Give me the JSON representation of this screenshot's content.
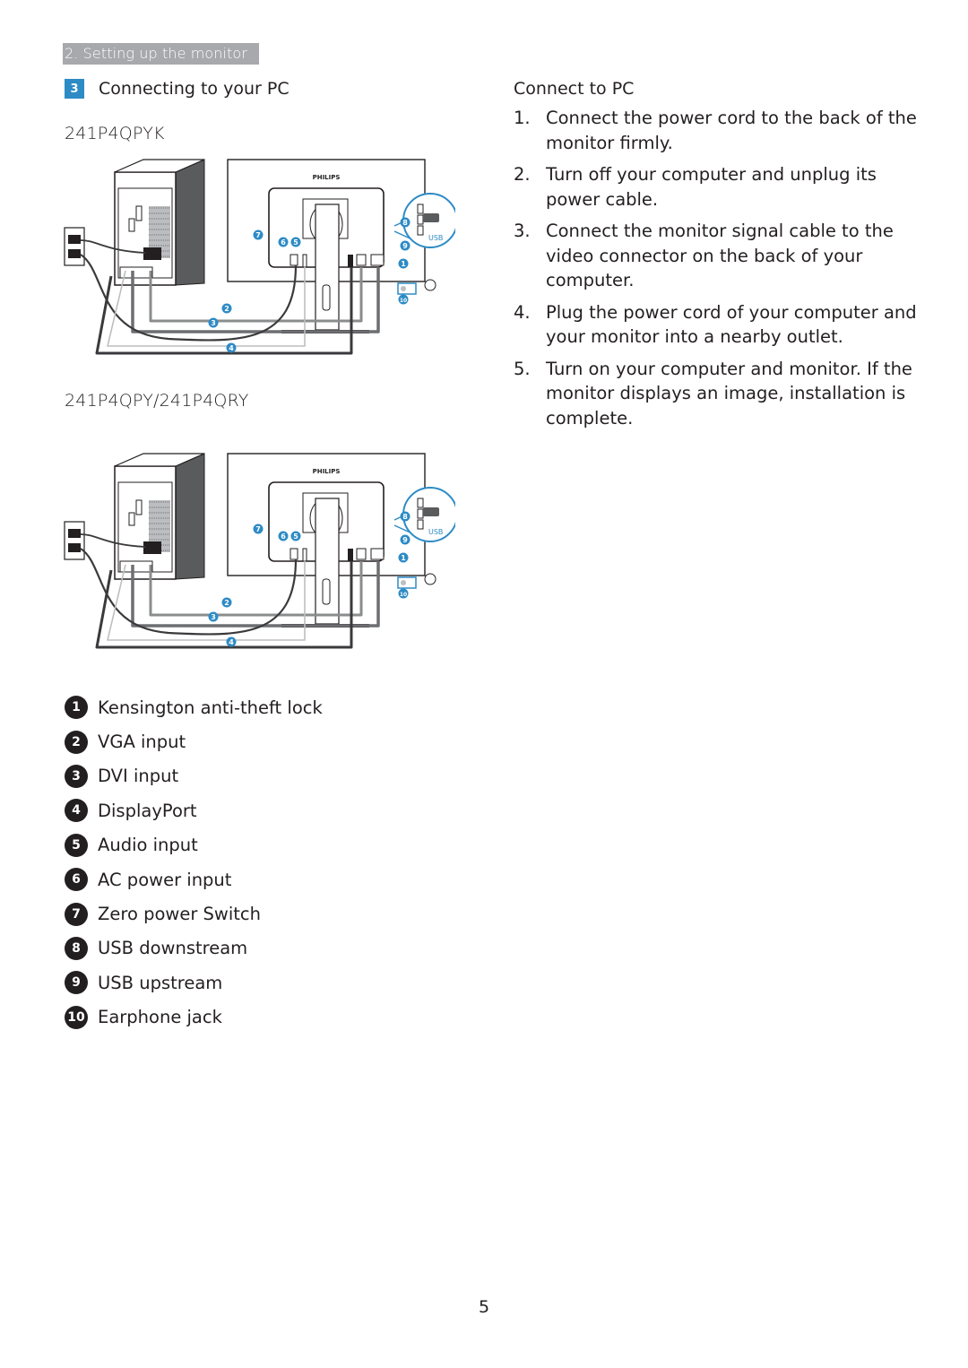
{
  "section_tab": "2. Setting up the monitor",
  "heading": {
    "number": "3",
    "title": "Connecting to your PC"
  },
  "diagrams": [
    {
      "model": "241P4QPYK",
      "brand": "PHILIPS",
      "usb_label": "USB",
      "callouts": [
        "1",
        "2",
        "3",
        "4",
        "5",
        "6",
        "7",
        "8",
        "9",
        "10"
      ]
    },
    {
      "model": "241P4QPY/241P4QRY",
      "brand": "PHILIPS",
      "usb_label": "USB",
      "callouts": [
        "1",
        "2",
        "3",
        "4",
        "5",
        "6",
        "7",
        "8",
        "9",
        "10"
      ]
    }
  ],
  "legend": [
    {
      "number": "1",
      "label": "Kensington anti-theft lock"
    },
    {
      "number": "2",
      "label": "VGA input"
    },
    {
      "number": "3",
      "label": "DVI input"
    },
    {
      "number": "4",
      "label": "DisplayPort"
    },
    {
      "number": "5",
      "label": "Audio input"
    },
    {
      "number": "6",
      "label": "AC power input"
    },
    {
      "number": "7",
      "label": "Zero power Switch"
    },
    {
      "number": "8",
      "label": "USB downstream"
    },
    {
      "number": "9",
      "label": "USB upstream"
    },
    {
      "number": "10",
      "label": "Earphone jack"
    }
  ],
  "connect": {
    "title": "Connect to PC",
    "steps": [
      {
        "number": "1.",
        "text": "Connect the power cord to the back of the monitor firmly."
      },
      {
        "number": "2.",
        "text": "Turn off your computer and unplug its power cable."
      },
      {
        "number": "3.",
        "text": "Connect the monitor signal cable to the video connector on the back of your computer."
      },
      {
        "number": "4.",
        "text": "Plug the power cord of your computer and your monitor into a nearby outlet."
      },
      {
        "number": "5.",
        "text": "Turn on your computer and monitor. If the monitor displays an image, installation is complete."
      }
    ]
  },
  "colors": {
    "accent": "#2d8bc5",
    "section_tab": "#a7a9ac",
    "text": "#231f20"
  },
  "page_number": "5"
}
